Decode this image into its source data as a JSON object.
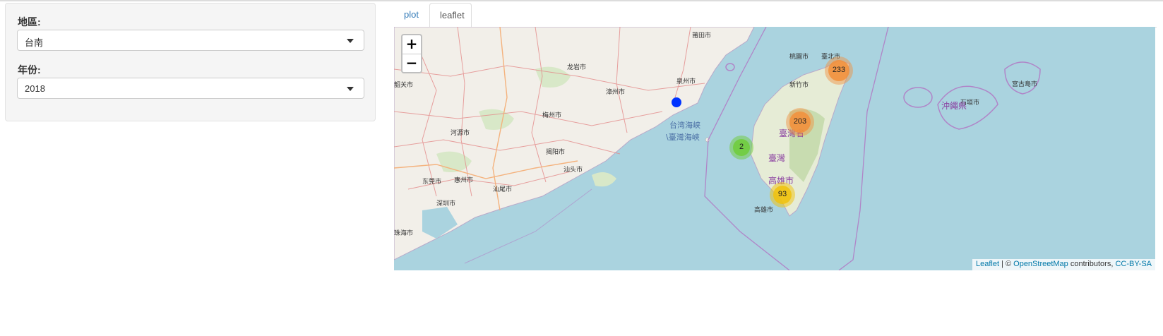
{
  "sidebar": {
    "region_label": "地區:",
    "region_value": "台南",
    "year_label": "年份:",
    "year_value": "2018"
  },
  "tabs": [
    {
      "label": "plot",
      "active": false
    },
    {
      "label": "leaflet",
      "active": true
    }
  ],
  "map": {
    "zoom_in": "+",
    "zoom_out": "−",
    "clusters": [
      {
        "count": "233",
        "color": "#f28f3b"
      },
      {
        "count": "203",
        "color": "#f28f3b"
      },
      {
        "count": "2",
        "color": "#6ecc39"
      },
      {
        "count": "93",
        "color": "#f0c20c"
      }
    ],
    "sea_labels": [
      "台湾海峡",
      "\\臺灣海峽"
    ],
    "region_labels": [
      "臺灣",
      "臺灣省",
      "高雄市",
      "沖繩県"
    ],
    "attribution": {
      "leaflet": "Leaflet",
      "sep": " | © ",
      "osm": "OpenStreetMap",
      "contrib": " contributors, ",
      "license": "CC-BY-SA"
    }
  },
  "colors": {
    "sea": "#aad3df",
    "land": "#f2efe9",
    "link": "#337ab7",
    "marker": "#0033ff"
  }
}
